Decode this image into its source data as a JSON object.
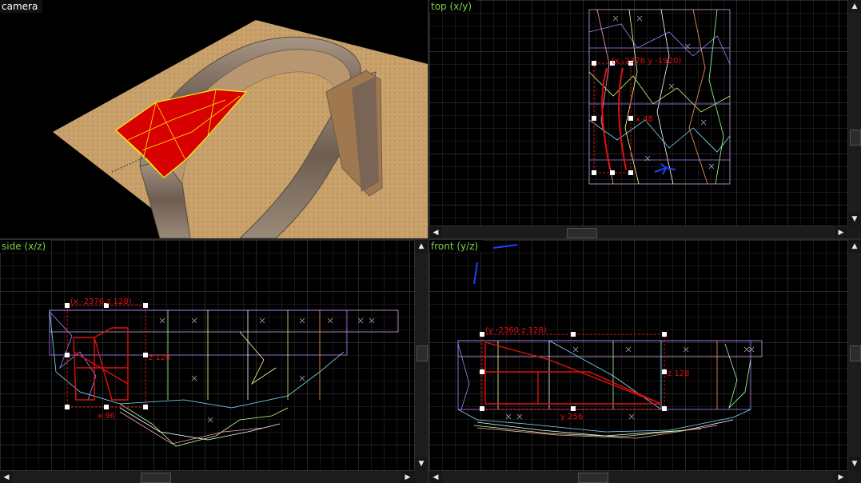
{
  "viewports": {
    "camera": {
      "label": "camera"
    },
    "top": {
      "label": "top (x/y)",
      "annotations": {
        "coord": "(x -2376 y -1920)",
        "size": "x 48"
      }
    },
    "side": {
      "label": "side (x/z)",
      "annotations": {
        "coord": "(x -2376 z 128)",
        "height": "z 128",
        "width": "x 96"
      }
    },
    "front": {
      "label": "front (y/z)",
      "annotations": {
        "coord": "(y -2360 z 128)",
        "height": "z 128",
        "width": "y 256"
      }
    }
  },
  "scrollbars": {
    "up_arrow": "▲",
    "down_arrow": "▼",
    "left_arrow": "◀",
    "right_arrow": "▶"
  },
  "colors": {
    "grid_minor": "#2c2c2c",
    "grid_major": "#4a4a4a",
    "selection_red": "#e01010",
    "label_green": "#7ad24a",
    "ground": "#c9a26b",
    "trench": "#8a7a6a",
    "brush_red": "#d80000"
  }
}
